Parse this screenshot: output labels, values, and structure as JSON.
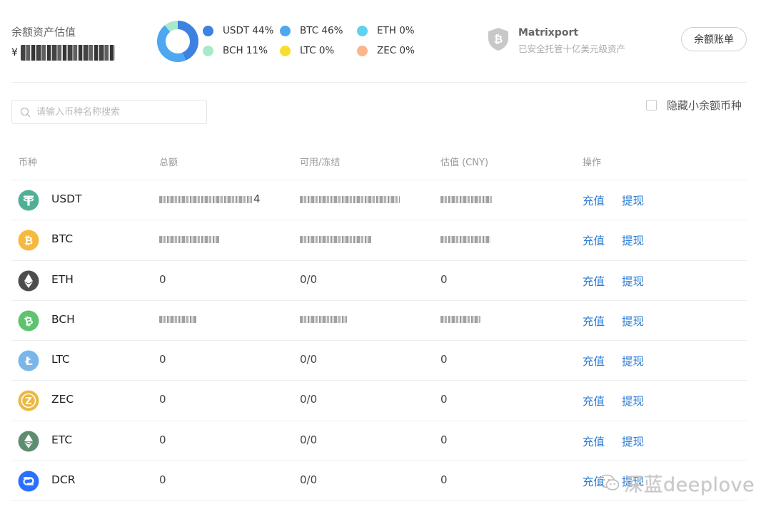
{
  "summary": {
    "label": "余额资产估值",
    "currency_symbol": "¥",
    "value_masked": ""
  },
  "allocation": {
    "items": [
      {
        "name": "USDT",
        "percent": 44,
        "label": "USDT 44%",
        "color": "#3d82e0"
      },
      {
        "name": "BTC",
        "percent": 46,
        "label": "BTC 46%",
        "color": "#4ea7f1"
      },
      {
        "name": "ETH",
        "percent": 0,
        "label": "ETH 0%",
        "color": "#5fd2ee"
      },
      {
        "name": "BCH",
        "percent": 11,
        "label": "BCH 11%",
        "color": "#a6eacb"
      },
      {
        "name": "LTC",
        "percent": 0,
        "label": "LTC 0%",
        "color": "#f8de2c"
      },
      {
        "name": "ZEC",
        "percent": 0,
        "label": "ZEC 0%",
        "color": "#fbb48c"
      }
    ]
  },
  "custody": {
    "title": "Matrixport",
    "subtitle": "已安全托管十亿美元级资产",
    "icon": "bitcoin-shield-icon"
  },
  "ledger_button": {
    "label": "余额账单"
  },
  "search": {
    "placeholder": "请输入币种名称搜索",
    "value": ""
  },
  "hide_small": {
    "label": "隐藏小余额币种",
    "checked": false
  },
  "table": {
    "headers": {
      "coin": "币种",
      "total": "总额",
      "available": "可用/冻结",
      "estimate": "估值 (CNY)",
      "actions": "操作"
    },
    "rows": [
      {
        "coin": "USDT",
        "icon_color": "#50af95",
        "icon": "tether-icon",
        "total": "",
        "total_suffix": "4",
        "available": "",
        "estimate": "",
        "masked": [
          130,
          140,
          72
        ],
        "deposit": "充值",
        "withdraw": "提现"
      },
      {
        "coin": "BTC",
        "icon_color": "#f5b940",
        "icon": "bitcoin-icon",
        "total": "",
        "total_suffix": "",
        "available": "",
        "estimate": "",
        "masked": [
          84,
          100,
          70
        ],
        "deposit": "充值",
        "withdraw": "提现"
      },
      {
        "coin": "ETH",
        "icon_color": "#4d4d4d",
        "icon": "ethereum-icon",
        "total": "0",
        "total_suffix": "",
        "available": "0/0",
        "estimate": "0",
        "masked": [
          0,
          0,
          0
        ],
        "deposit": "充值",
        "withdraw": "提现"
      },
      {
        "coin": "BCH",
        "icon_color": "#5dc36f",
        "icon": "bitcoin-cash-icon",
        "total": "",
        "total_suffix": "",
        "available": "",
        "estimate": "",
        "masked": [
          52,
          66,
          56
        ],
        "deposit": "充值",
        "withdraw": "提现"
      },
      {
        "coin": "LTC",
        "icon_color": "#7bb6e8",
        "icon": "litecoin-icon",
        "total": "0",
        "total_suffix": "",
        "available": "0/0",
        "estimate": "0",
        "masked": [
          0,
          0,
          0
        ],
        "deposit": "充值",
        "withdraw": "提现"
      },
      {
        "coin": "ZEC",
        "icon_color": "#ecb844",
        "icon": "zcash-icon",
        "total": "0",
        "total_suffix": "",
        "available": "0/0",
        "estimate": "0",
        "masked": [
          0,
          0,
          0
        ],
        "deposit": "充值",
        "withdraw": "提现"
      },
      {
        "coin": "ETC",
        "icon_color": "#5e8c6e",
        "icon": "ethereum-classic-icon",
        "total": "0",
        "total_suffix": "",
        "available": "0/0",
        "estimate": "0",
        "masked": [
          0,
          0,
          0
        ],
        "deposit": "充值",
        "withdraw": "提现"
      },
      {
        "coin": "DCR",
        "icon_color": "#2970ff",
        "icon": "decred-icon",
        "total": "0",
        "total_suffix": "",
        "available": "0/0",
        "estimate": "0",
        "masked": [
          0,
          0,
          0
        ],
        "deposit": "充值",
        "withdraw": "提现"
      }
    ]
  },
  "watermark": {
    "text": "深蓝deeplove",
    "icon": "wechat-icon"
  }
}
